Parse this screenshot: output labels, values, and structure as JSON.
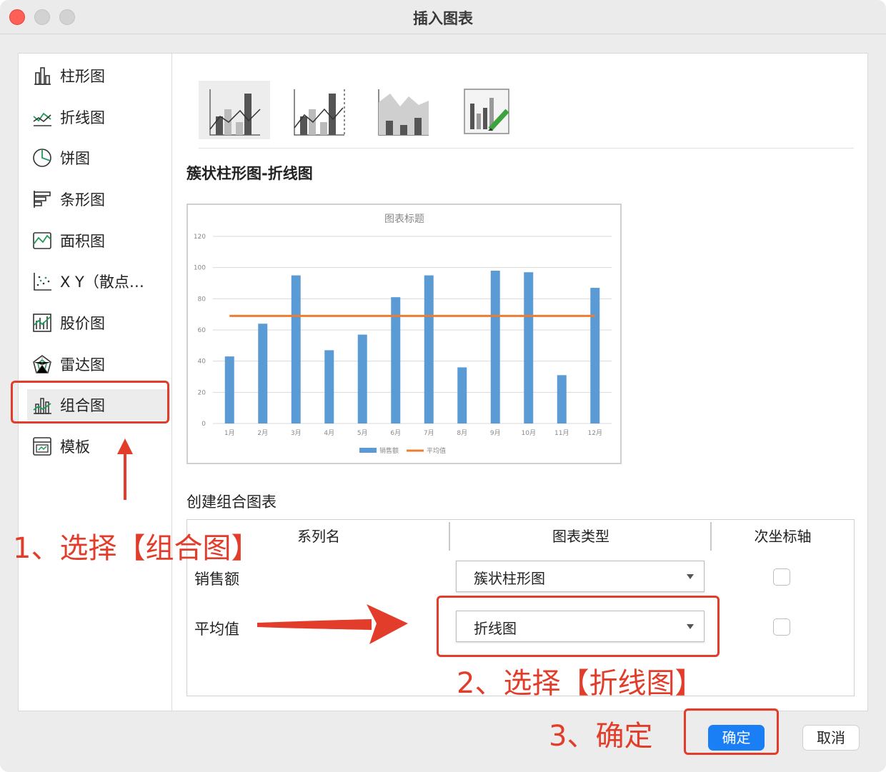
{
  "window": {
    "title": "插入图表"
  },
  "sidebar": {
    "items": [
      {
        "label": "柱形图",
        "icon": "column-chart-icon"
      },
      {
        "label": "折线图",
        "icon": "line-chart-icon"
      },
      {
        "label": "饼图",
        "icon": "pie-chart-icon"
      },
      {
        "label": "条形图",
        "icon": "bar-chart-icon"
      },
      {
        "label": "面积图",
        "icon": "area-chart-icon"
      },
      {
        "label": "X Y（散点…",
        "icon": "scatter-chart-icon"
      },
      {
        "label": "股价图",
        "icon": "stock-chart-icon"
      },
      {
        "label": "雷达图",
        "icon": "radar-chart-icon"
      },
      {
        "label": "组合图",
        "icon": "combo-chart-icon",
        "selected": true
      },
      {
        "label": "模板",
        "icon": "template-icon"
      }
    ]
  },
  "subtypes": {
    "selected_index": 0
  },
  "chart_name": "簇状柱形图-折线图",
  "preview": {
    "chart_data": {
      "type": "bar",
      "title": "图表标题",
      "categories": [
        "1月",
        "2月",
        "3月",
        "4月",
        "5月",
        "6月",
        "7月",
        "8月",
        "9月",
        "10月",
        "11月",
        "12月"
      ],
      "series": [
        {
          "name": "销售额",
          "type": "bar",
          "color": "#5b9bd5",
          "values": [
            43,
            64,
            95,
            47,
            57,
            81,
            95,
            36,
            98,
            97,
            31,
            87
          ]
        },
        {
          "name": "平均值",
          "type": "line",
          "color": "#ed7d31",
          "values": [
            69,
            69,
            69,
            69,
            69,
            69,
            69,
            69,
            69,
            69,
            69,
            69
          ]
        }
      ],
      "yticks": [
        "0",
        "20",
        "40",
        "60",
        "80",
        "100",
        "120"
      ],
      "ylim": [
        0,
        120
      ],
      "grid": true,
      "legend": "bottom"
    }
  },
  "create_section": {
    "label": "创建组合图表",
    "headers": {
      "series": "系列名",
      "type": "图表类型",
      "secondary": "次坐标轴"
    },
    "rows": [
      {
        "name": "销售额",
        "type": "簇状柱形图",
        "secondary": false
      },
      {
        "name": "平均值",
        "type": "折线图",
        "secondary": false
      }
    ]
  },
  "buttons": {
    "ok": "确定",
    "cancel": "取消"
  },
  "annotations": {
    "color": "#e23d2b",
    "step1": "1、选择【组合图】",
    "step2": "2、选择【折线图】",
    "step3": "3、确定"
  }
}
